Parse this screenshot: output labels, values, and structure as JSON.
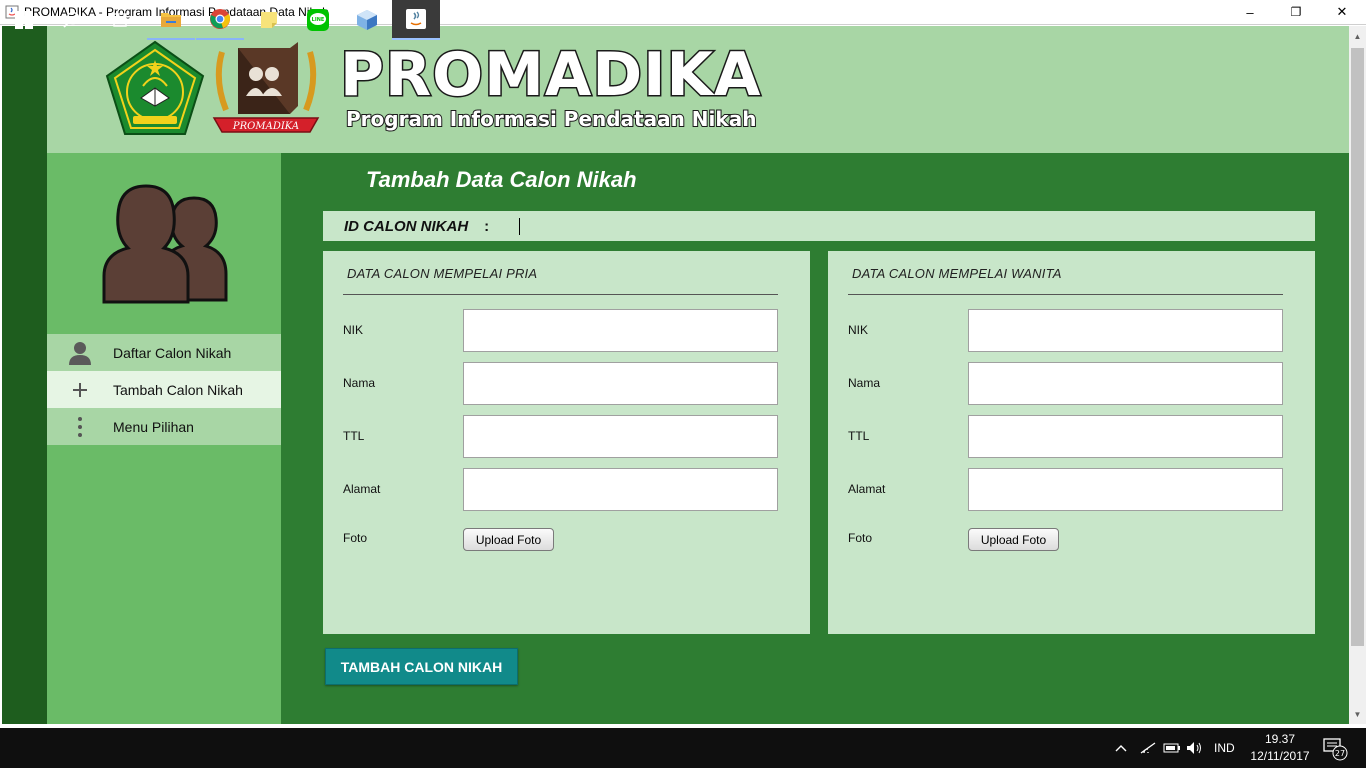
{
  "window": {
    "title": "PROMADIKA - Program Informasi Pendataan Data Nikah",
    "minimize_glyph": "–",
    "maximize_glyph": "❐",
    "close_glyph": "✕"
  },
  "header": {
    "brand_title": "PROMADIKA",
    "brand_subtitle": "Program Informasi Pendataan Nikah",
    "logo_left": "kemenag-emblem",
    "logo_right_text": "PROMADIKA"
  },
  "sidebar": {
    "items": [
      {
        "label": "Daftar Calon Nikah",
        "icon": "person-icon"
      },
      {
        "label": "Tambah Calon Nikah",
        "icon": "plus-icon"
      },
      {
        "label": "Menu Pilihan",
        "icon": "more-vertical-icon"
      }
    ]
  },
  "main": {
    "title": "Tambah Data Calon Nikah",
    "id_label": "ID CALON NIKAH",
    "id_colon": ":",
    "id_value": "",
    "panels": [
      {
        "heading": "DATA CALON MEMPELAI PRIA",
        "fields": {
          "nik": "NIK",
          "nama": "Nama",
          "ttl": "TTL",
          "alamat": "Alamat",
          "foto": "Foto"
        },
        "values": {
          "nik": "",
          "nama": "",
          "ttl": "",
          "alamat": ""
        },
        "upload_label": "Upload Foto"
      },
      {
        "heading": "DATA CALON MEMPELAI WANITA",
        "fields": {
          "nik": "NIK",
          "nama": "Nama",
          "ttl": "TTL",
          "alamat": "Alamat",
          "foto": "Foto"
        },
        "values": {
          "nik": "",
          "nama": "",
          "ttl": "",
          "alamat": ""
        },
        "upload_label": "Upload Foto"
      }
    ],
    "submit_label": "TAMBAH CALON NIKAH"
  },
  "taskbar": {
    "language": "IND",
    "time": "19.37",
    "date": "12/11/2017",
    "notification_count": "27"
  },
  "colors": {
    "header_bg": "#a8d6a5",
    "sidebar_bg": "#6abb67",
    "main_bg": "#2e7d32",
    "panel_bg": "#c8e6c9",
    "submit_bg": "#118a8a"
  }
}
